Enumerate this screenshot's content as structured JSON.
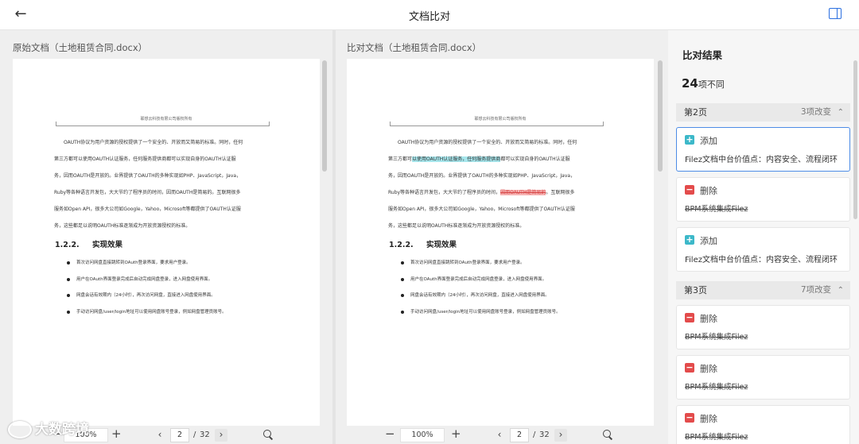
{
  "header": {
    "title": "文档比对",
    "back_icon": "arrow-left-icon",
    "toggle_icon": "split-panel-icon",
    "accent": "#2b6fe0"
  },
  "left_doc": {
    "label": "原始文档（土地租赁合同.docx）",
    "zoom": "100%",
    "page": "2",
    "total": "32",
    "header_text": "联想云科技有限公司版权所有",
    "paragraph_lines": [
      "OAUTH协议为用户资源的授权提供了一个安全的、开放而又简易的标准。同时，任何",
      "第三方都可以使用OAUTH认证服务，任何服务提供商都可以实现自身的OAUTH认证服",
      "务，因而OAUTH是开放的。业界提供了OAUTH的多种实现如PHP、JavaScript，Java，",
      "Ruby等各种语言开发包，大大节约了程序员的时间，因而OAUTH是简易的。互联网很多",
      "服务如Open API，很多大公司如Google，Yahoo，Microsoft等都提供了OAUTH认证服",
      "务，这些都足以说明OAUTH标准逐渐成为开放资源授权的标准。"
    ],
    "section_num": "1.2.2.",
    "section_title": "实现效果",
    "bullets": [
      "首次访问网盘直接跳转到OAuth登录界面，要求用户登录。",
      "用户在OAuth界面登录完成后自动完成网盘登录，进入网盘使用界面。",
      "网盘会话有效期内（24小时），再次访问网盘，直接进入网盘使用界面。",
      "手动访问网盘/user/login地址可以使用网盘账号登录，例如网盘管理员账号。"
    ]
  },
  "right_doc": {
    "label": "比对文档（土地租赁合同.docx）",
    "zoom": "100%",
    "page": "2",
    "total": "32",
    "header_text": "联想云科技有限公司版权所有",
    "line1": "OAUTH协议为用户资源的授权提供了一个安全的、开放而又简易的标准。同时，任何",
    "line2_pre": "第三方都可",
    "line2_add": "以使用OAUTH认证服务，任何服务提供商",
    "line2_post": "都可以实现自身的OAUTH认证服",
    "line3": "务，因而OAUTH是开放的。业界提供了OAUTH的多种实现如PHP、JavaScript，Java，",
    "line4_pre": "Ruby等各种语言开发包，大大节约了程序员的时间，",
    "line4_del": "因而OAUTH是简易的",
    "line4_post": "。互联网很多",
    "line5": "服务如Open API，很多大公司如Google，Yahoo，Microsoft等都提供了OAUTH认证服",
    "line6": "务，这些都足以说明OAUTH标准逐渐成为开放资源授权的标准。",
    "section_num": "1.2.2.",
    "section_title": "实现效果",
    "bullets": [
      "首次访问网盘直接跳转到OAuth登录界面，要求用户登录。",
      "用户在OAuth界面登录完成后自动完成网盘登录，进入网盘使用界面。",
      "网盘会话有效期内（24小时），再次访问网盘，直接进入网盘使用界面。",
      "手动访问网盘/user/login地址可以使用网盘账号登录，例如网盘管理员账号。"
    ]
  },
  "toolbar": {
    "minus": "−",
    "plus": "+",
    "slash": "/",
    "prev": "‹",
    "next": "›"
  },
  "results": {
    "title": "比对结果",
    "count_num": "24",
    "count_suffix": "项不同",
    "groups": [
      {
        "label": "第2页",
        "changes": "3项改变",
        "chev": "⌃"
      },
      {
        "label": "第3页",
        "changes": "7项改变",
        "chev": "⌃"
      }
    ],
    "cards": [
      {
        "type": "添加",
        "text": "Filez文档中台价值点：内容安全、流程闭环",
        "badge": "+"
      },
      {
        "type": "删除",
        "text": "BPM系统集成Filez",
        "badge": "−"
      },
      {
        "type": "添加",
        "text": "Filez文档中台价值点：内容安全、流程闭环",
        "badge": "+"
      },
      {
        "type": "删除",
        "text": "BPM系统集成Filez",
        "badge": "−"
      },
      {
        "type": "删除",
        "text": "BPM系统集成Filez",
        "badge": "−"
      },
      {
        "type": "删除",
        "text": "BPM系统集成Filez",
        "badge": "−"
      }
    ],
    "add_color": "#3cb8c9",
    "del_color": "#e34b4b"
  },
  "watermark": {
    "text": "大数跨境"
  }
}
